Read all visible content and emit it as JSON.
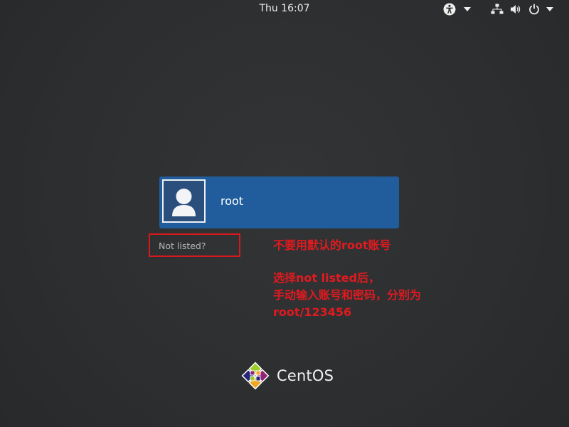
{
  "topbar": {
    "clock_day": "Thu",
    "clock_time": "16:07",
    "icons": [
      "accessibility-icon",
      "chevron-down-icon",
      "network-icon",
      "volume-icon",
      "power-icon",
      "chevron-down-icon"
    ]
  },
  "user_list": {
    "users": [
      {
        "name": "root",
        "avatar_icon": "user-avatar-icon"
      }
    ],
    "not_listed_label": "Not listed?"
  },
  "annotations": {
    "line1": "不要用默认的root账号",
    "line2": "选择not listed后，",
    "line3": "手动输入账号和密码，分别为",
    "line4": "root/123456"
  },
  "branding": {
    "logo_text": "CentOS"
  },
  "colors": {
    "background": "#2d2f31",
    "selected_user": "#215d9c",
    "annotation": "#e01a1f"
  }
}
